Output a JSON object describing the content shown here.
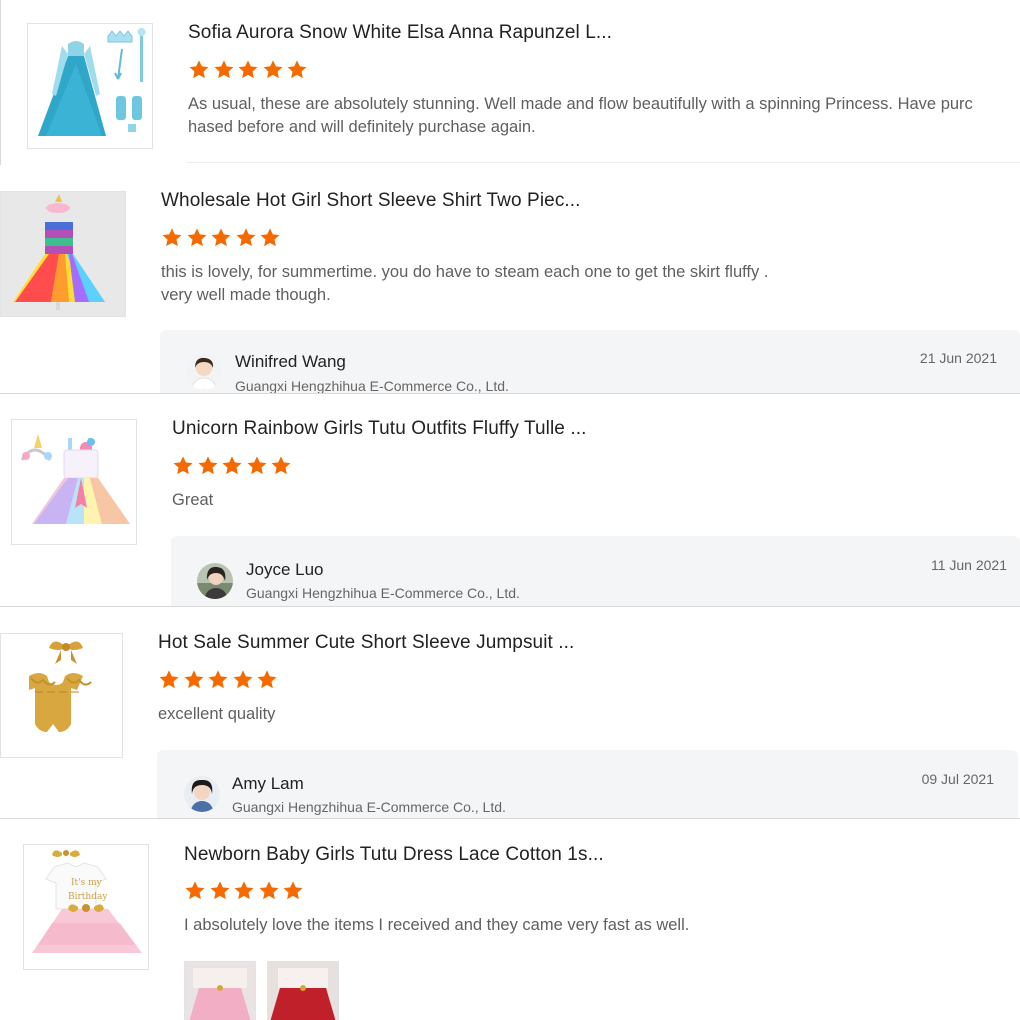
{
  "colors": {
    "star": "#f56a00",
    "reply_bg": "#f4f5f7",
    "divider": "#d9d9d9"
  },
  "reviews": [
    {
      "product_title": "Sofia Aurora Snow White Elsa Anna Rapunzel L...",
      "rating": 5,
      "text_lines": [
        "As usual, these are absolutely stunning. Well made and flow beautifully with a spinning Princess. Have purc",
        "hased before and will definitely purchase again."
      ],
      "thumbnail_icon": "blue-princess-dress-icon"
    },
    {
      "product_title": "Wholesale Hot Girl Short Sleeve Shirt Two Piec...",
      "rating": 5,
      "text_lines": [
        "this is lovely, for summertime. you do have to steam each one to get the skirt fluffy .",
        "very well made though."
      ],
      "thumbnail_icon": "rainbow-tutu-dress-icon",
      "reply": {
        "name": "Winifred Wang",
        "company": "Guangxi Hengzhihua E-Commerce Co., Ltd.",
        "date": "21 Jun 2021"
      }
    },
    {
      "product_title": "Unicorn Rainbow Girls Tutu Outfits Fluffy Tulle ...",
      "rating": 5,
      "text_lines": [
        "Great"
      ],
      "thumbnail_icon": "unicorn-tutu-dress-icon",
      "reply": {
        "name": "Joyce Luo",
        "company": "Guangxi Hengzhihua E-Commerce Co., Ltd.",
        "date": "11 Jun 2021"
      }
    },
    {
      "product_title": "Hot Sale Summer Cute Short Sleeve Jumpsuit ...",
      "rating": 5,
      "text_lines": [
        "excellent quality"
      ],
      "thumbnail_icon": "gold-jumpsuit-icon",
      "reply": {
        "name": "Amy Lam",
        "company": "Guangxi Hengzhihua E-Commerce Co., Ltd.",
        "date": "09 Jul 2021"
      }
    },
    {
      "product_title": "Newborn Baby Girls Tutu Dress Lace Cotton 1s...",
      "rating": 5,
      "text_lines": [
        "I absolutely love the items I received and they came very fast as well."
      ],
      "thumbnail_icon": "birthday-tutu-dress-icon",
      "photos": [
        "pink-tutu-photo-icon",
        "red-tutu-photo-icon"
      ]
    }
  ]
}
